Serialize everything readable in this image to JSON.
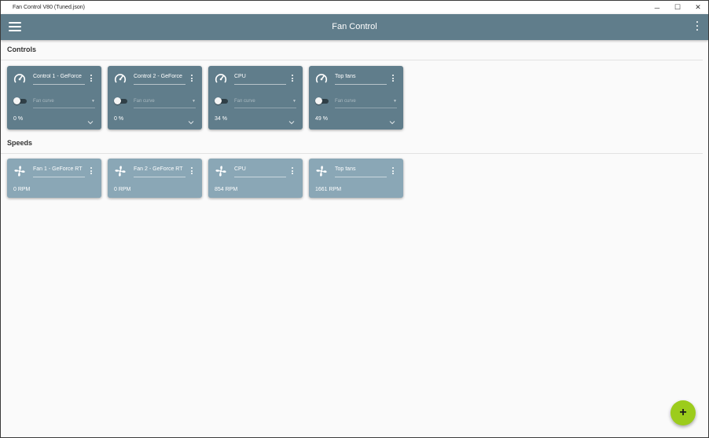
{
  "window": {
    "title": "Fan Control V80 (Tuned.json)",
    "minimize": "─",
    "maximize": "☐",
    "close": "✕"
  },
  "appbar": {
    "title": "Fan Control"
  },
  "sections": {
    "controls": "Controls",
    "speeds": "Speeds"
  },
  "controls": [
    {
      "name": "Control 1 - GeForce",
      "curve_placeholder": "Fan curve",
      "value": "0 %",
      "icon": "speedometer-icon",
      "enabled": false
    },
    {
      "name": "Control 2 - GeForce",
      "curve_placeholder": "Fan curve",
      "value": "0 %",
      "icon": "speedometer-icon",
      "enabled": false
    },
    {
      "name": "CPU",
      "curve_placeholder": "Fan curve",
      "value": "34 %",
      "icon": "speedometer-icon",
      "enabled": false
    },
    {
      "name": "Top fans",
      "curve_placeholder": "Fan curve",
      "value": "49 %",
      "icon": "speedometer-icon",
      "enabled": false
    }
  ],
  "speeds": [
    {
      "name": "Fan 1 - GeForce RT",
      "value": "0 RPM",
      "icon": "fan-icon"
    },
    {
      "name": "Fan 2 - GeForce RT",
      "value": "0 RPM",
      "icon": "fan-icon"
    },
    {
      "name": "CPU",
      "value": "854 RPM",
      "icon": "fan-icon"
    },
    {
      "name": "Top fans",
      "value": "1661 RPM",
      "icon": "fan-icon"
    }
  ],
  "fab": {
    "label": "+"
  },
  "colors": {
    "appbar": "#607d8b",
    "control_card": "#607d8b",
    "speed_card": "#8aa7b6",
    "fab": "#9ccc1c"
  }
}
